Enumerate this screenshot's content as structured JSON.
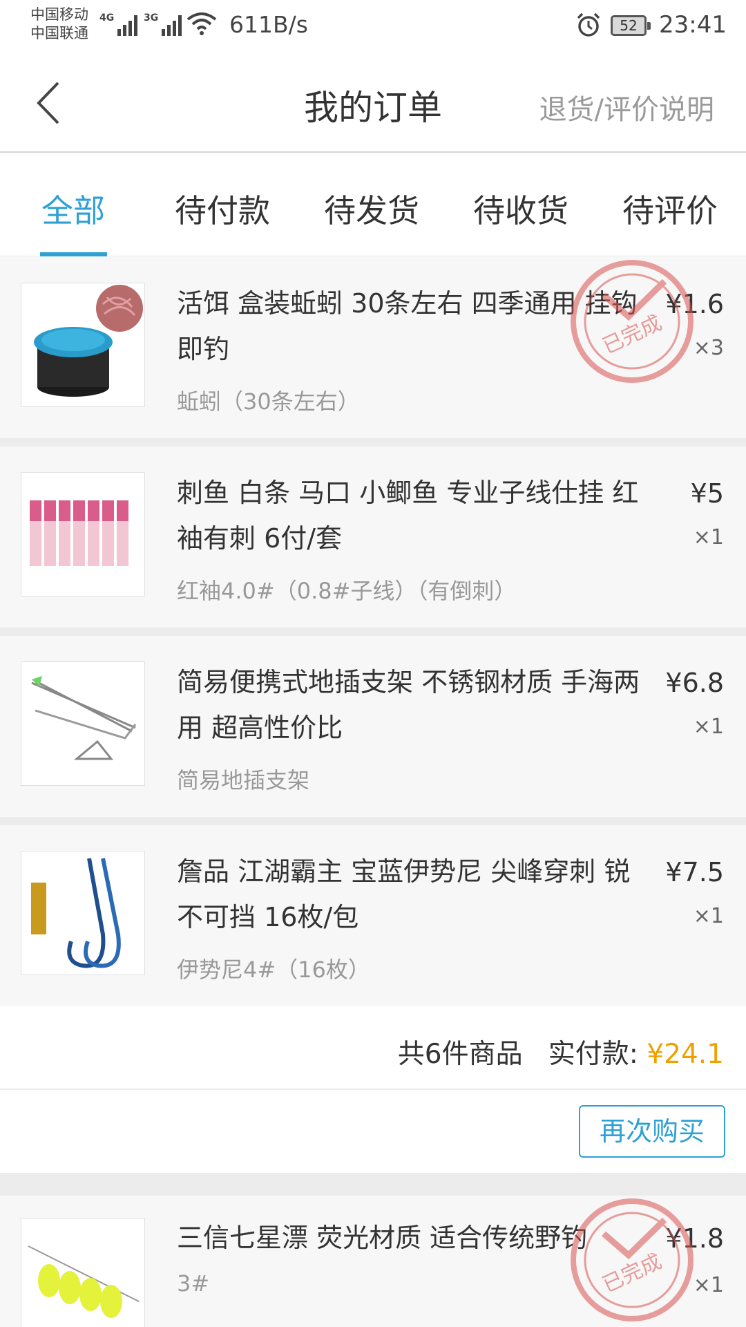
{
  "status_bar": {
    "carrier_1": "中国移动",
    "carrier_2": "中国联通",
    "signal_1_type": "4G",
    "signal_2_type": "3G",
    "net_speed": "611B/s",
    "battery_level": "52",
    "time": "23:41",
    "icons": [
      "signal-icon",
      "wifi-icon",
      "alarm-icon",
      "battery-icon"
    ]
  },
  "header": {
    "title": "我的订单",
    "help_link": "退货/评价说明",
    "back_icon": "back-arrow-icon"
  },
  "tabs": [
    {
      "label": "全部",
      "active": true
    },
    {
      "label": "待付款",
      "active": false
    },
    {
      "label": "待发货",
      "active": false
    },
    {
      "label": "待收货",
      "active": false
    },
    {
      "label": "待评价",
      "active": false
    }
  ],
  "order1": {
    "items": [
      {
        "title": "活饵 盒装蚯蚓 30条左右 四季通用 挂钩即钓",
        "price": "¥1.6",
        "qty": "×3",
        "variant": "蚯蚓（30条左右）"
      },
      {
        "title": "刺鱼 白条 马口 小鲫鱼 专业子线仕挂 红袖有刺 6付/套",
        "price": "¥5",
        "qty": "×1",
        "variant": "红袖4.0#（0.8#子线）（有倒刺）"
      },
      {
        "title": "简易便携式地插支架 不锈钢材质 手海两用 超高性价比",
        "price": "¥6.8",
        "qty": "×1",
        "variant": "简易地插支架"
      },
      {
        "title": "詹品 江湖霸主 宝蓝伊势尼 尖峰穿刺 锐不可挡 16枚/包",
        "price": "¥7.5",
        "qty": "×1",
        "variant": "伊势尼4#（16枚）"
      }
    ],
    "stamp_text": "已完成",
    "summary_count": "共6件商品",
    "summary_label": "实付款:",
    "summary_price": "¥24.1",
    "rebuy_label": "再次购买"
  },
  "order2": {
    "items": [
      {
        "title": "三信七星漂 荧光材质 适合传统野钓",
        "price": "¥1.8",
        "qty": "×1",
        "variant": "3#"
      }
    ],
    "stamp_text": "已完成"
  },
  "colors": {
    "accent": "#2ea0d4",
    "price_highlight": "#f0a100",
    "stamp": "#d9534f",
    "list_background": "#ececec"
  }
}
